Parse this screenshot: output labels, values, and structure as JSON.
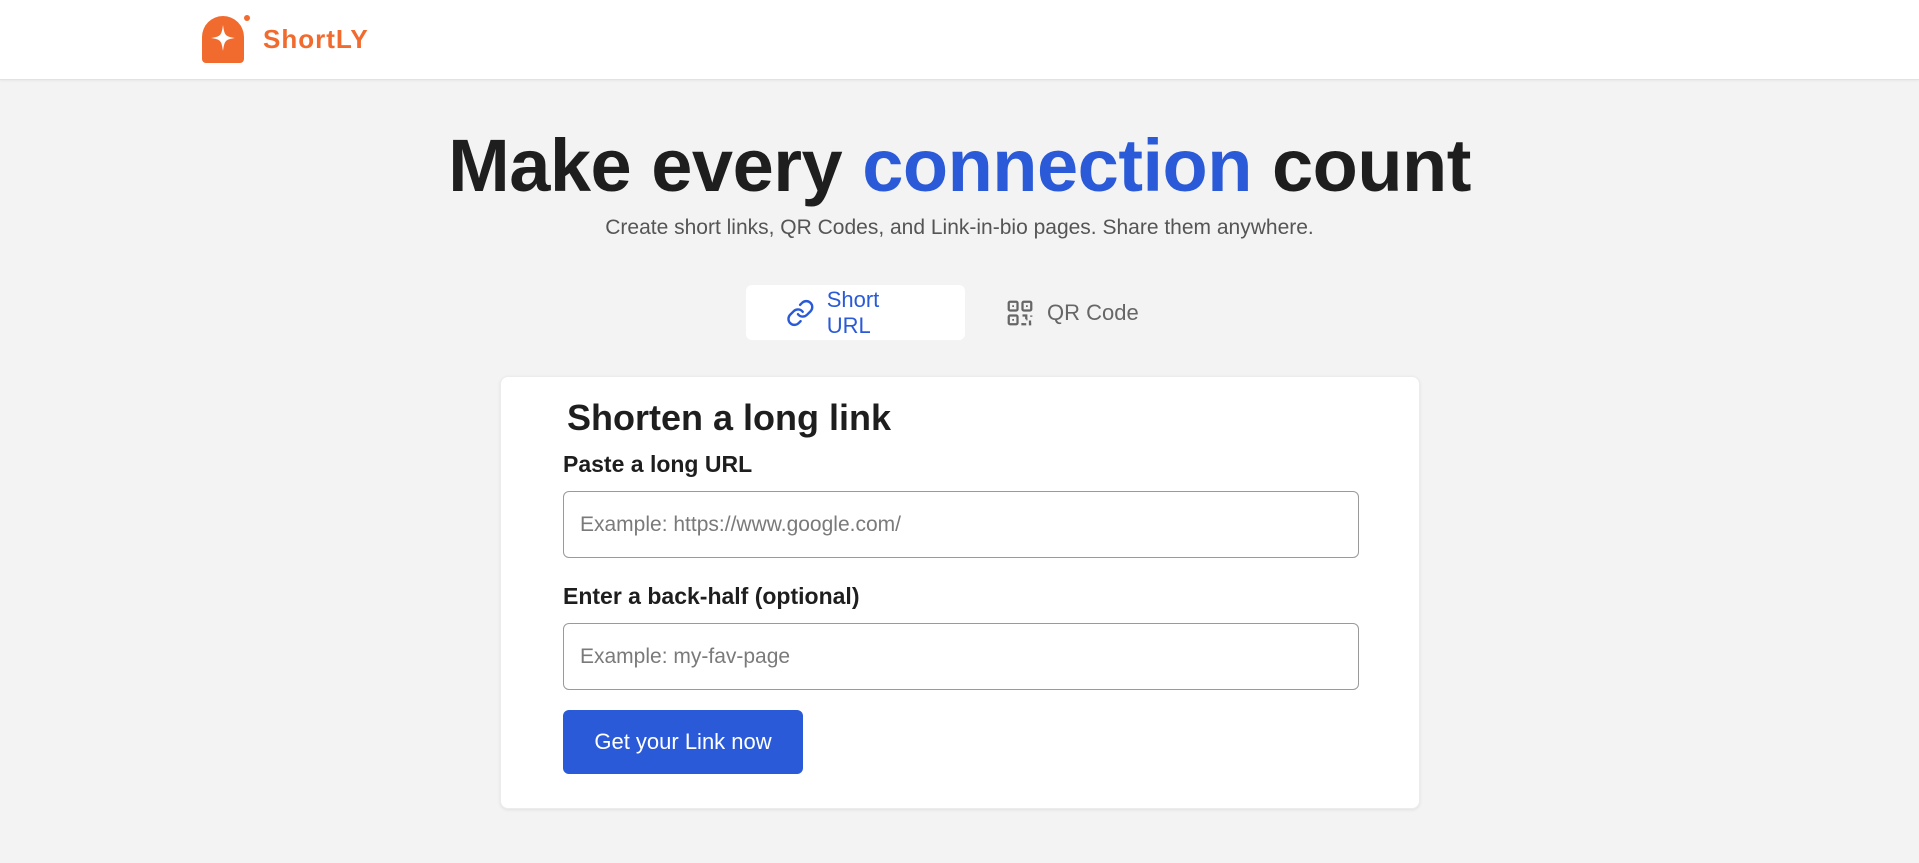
{
  "app": {
    "brand_name": "ShortLY",
    "brand_color": "#f26b2e",
    "logo_icon": "shortly-logo-icon"
  },
  "hero": {
    "title_before": "Make every ",
    "title_accent": "connection",
    "title_after": " count",
    "accent_color": "#2a5ad8",
    "subtitle": "Create short links, QR Codes, and Link-in-bio pages. Share them anywhere."
  },
  "tabs": [
    {
      "label": "Short URL",
      "icon": "link-icon",
      "active": true
    },
    {
      "label": "QR Code",
      "icon": "qr-code-icon",
      "active": false
    }
  ],
  "form": {
    "title": "Shorten a long link",
    "long_url": {
      "label": "Paste a long URL",
      "placeholder": "Example: https://www.google.com/",
      "value": ""
    },
    "back_half": {
      "label": "Enter a back-half (optional)",
      "placeholder": "Example: my-fav-page",
      "value": ""
    },
    "submit_label": "Get your Link now",
    "button_color": "#2a5ad8"
  }
}
